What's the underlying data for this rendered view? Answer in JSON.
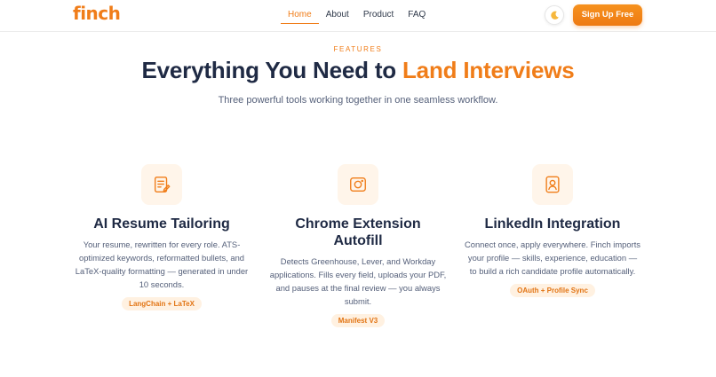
{
  "brand": {
    "logo_text": "finch",
    "accent_color": "#f07d19"
  },
  "nav": {
    "links": [
      {
        "label": "Home",
        "active": true
      },
      {
        "label": "About",
        "active": false
      },
      {
        "label": "Product",
        "active": false
      },
      {
        "label": "FAQ",
        "active": false
      }
    ],
    "theme_toggle_icon": "moon-icon",
    "cta_label": "Sign Up Free"
  },
  "hero": {
    "eyebrow": "FEATURES",
    "headline_main": "Everything You Need to ",
    "headline_accent": "Land Interviews",
    "subheadline": "Three powerful tools working together in one seamless workflow."
  },
  "features": [
    {
      "icon": "document-edit-icon",
      "title": "AI Resume Tailoring",
      "description": "Your resume, rewritten for every role. ATS-optimized keywords, reformatted bullets, and LaTeX-quality formatting — generated in under 10 seconds.",
      "badge": "LangChain + LaTeX"
    },
    {
      "icon": "camera-icon",
      "title": "Chrome Extension Autofill",
      "description": "Detects Greenhouse, Lever, and Workday applications. Fills every field, uploads your PDF, and pauses at the final review — you always submit.",
      "badge": "Manifest V3"
    },
    {
      "icon": "profile-card-icon",
      "title": "LinkedIn Integration",
      "description": "Connect once, apply everywhere. Finch imports your profile — skills, experience, education — to build a rich candidate profile automatically.",
      "badge": "OAuth + Profile Sync"
    }
  ]
}
